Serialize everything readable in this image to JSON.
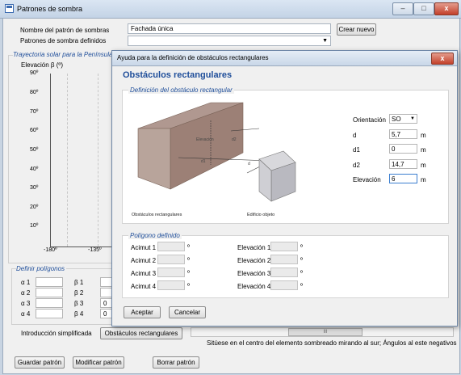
{
  "window": {
    "title": "Patrones de sombra",
    "min": "–",
    "max": "□",
    "close": "x"
  },
  "form": {
    "pattern_name_label": "Nombre del patrón de sombras",
    "pattern_name_value": "Fachada única",
    "create_button": "Crear nuevo",
    "defined_patterns_label": "Patrones de sombra definidos",
    "defined_patterns_value": ""
  },
  "chart": {
    "group_title": "Trayectoria solar para la Península Ibérica",
    "y_title": "Elevación β (º)",
    "y_ticks": [
      "90º",
      "80º",
      "70º",
      "60º",
      "50º",
      "40º",
      "30º",
      "20º",
      "10º"
    ],
    "x_ticks": [
      "-180º",
      "-135º"
    ]
  },
  "polygons": {
    "group_title": "Definir polígonos",
    "rows": [
      {
        "a": "α 1",
        "b": "β 1",
        "bval": ""
      },
      {
        "a": "α 2",
        "b": "β 2",
        "bval": ""
      },
      {
        "a": "α 3",
        "b": "β 3",
        "bval": "0"
      },
      {
        "a": "α 4",
        "b": "β 4",
        "bval": "0"
      }
    ],
    "simplified_label": "Introducción simplificada",
    "rect_button": "Obstáculos rectangulares",
    "hint": "Sitúese en el centro del elemento sombreado mirando al sur; Ángulos al este negativos",
    "scroll_marker": "III"
  },
  "bottom_buttons": {
    "save": "Guardar patrón",
    "modify": "Modificar patrón",
    "delete": "Borrar patrón"
  },
  "dialog": {
    "title": "Ayuda para la definición de obstáculos rectangulares",
    "close": "x",
    "heading": "Obstáculos rectangulares",
    "def_group": "Definición del obstáculo rectangular",
    "diagram": {
      "caption_left": "Obstáculos rectangulares",
      "caption_right": "Edificio objeto",
      "elev": "Elevación",
      "d": "d",
      "d1": "d1",
      "d2": "d2"
    },
    "fields": [
      {
        "label": "Orientación",
        "value": "SO",
        "unit": ""
      },
      {
        "label": "d",
        "value": "5,7",
        "unit": "m"
      },
      {
        "label": "d1",
        "value": "0",
        "unit": "m"
      },
      {
        "label": "d2",
        "value": "14,7",
        "unit": "m"
      },
      {
        "label": "Elevación",
        "value": "6",
        "unit": "m"
      }
    ],
    "poly_group": "Polígono definido",
    "azimuths": [
      "Acimut 1",
      "Acimut 2",
      "Acimut 3",
      "Acimut 4"
    ],
    "elevations": [
      "Elevación 1",
      "Elevación 2",
      "Elevación 3",
      "Elevación 4"
    ],
    "deg": "º",
    "accept": "Aceptar",
    "cancel": "Cancelar"
  }
}
